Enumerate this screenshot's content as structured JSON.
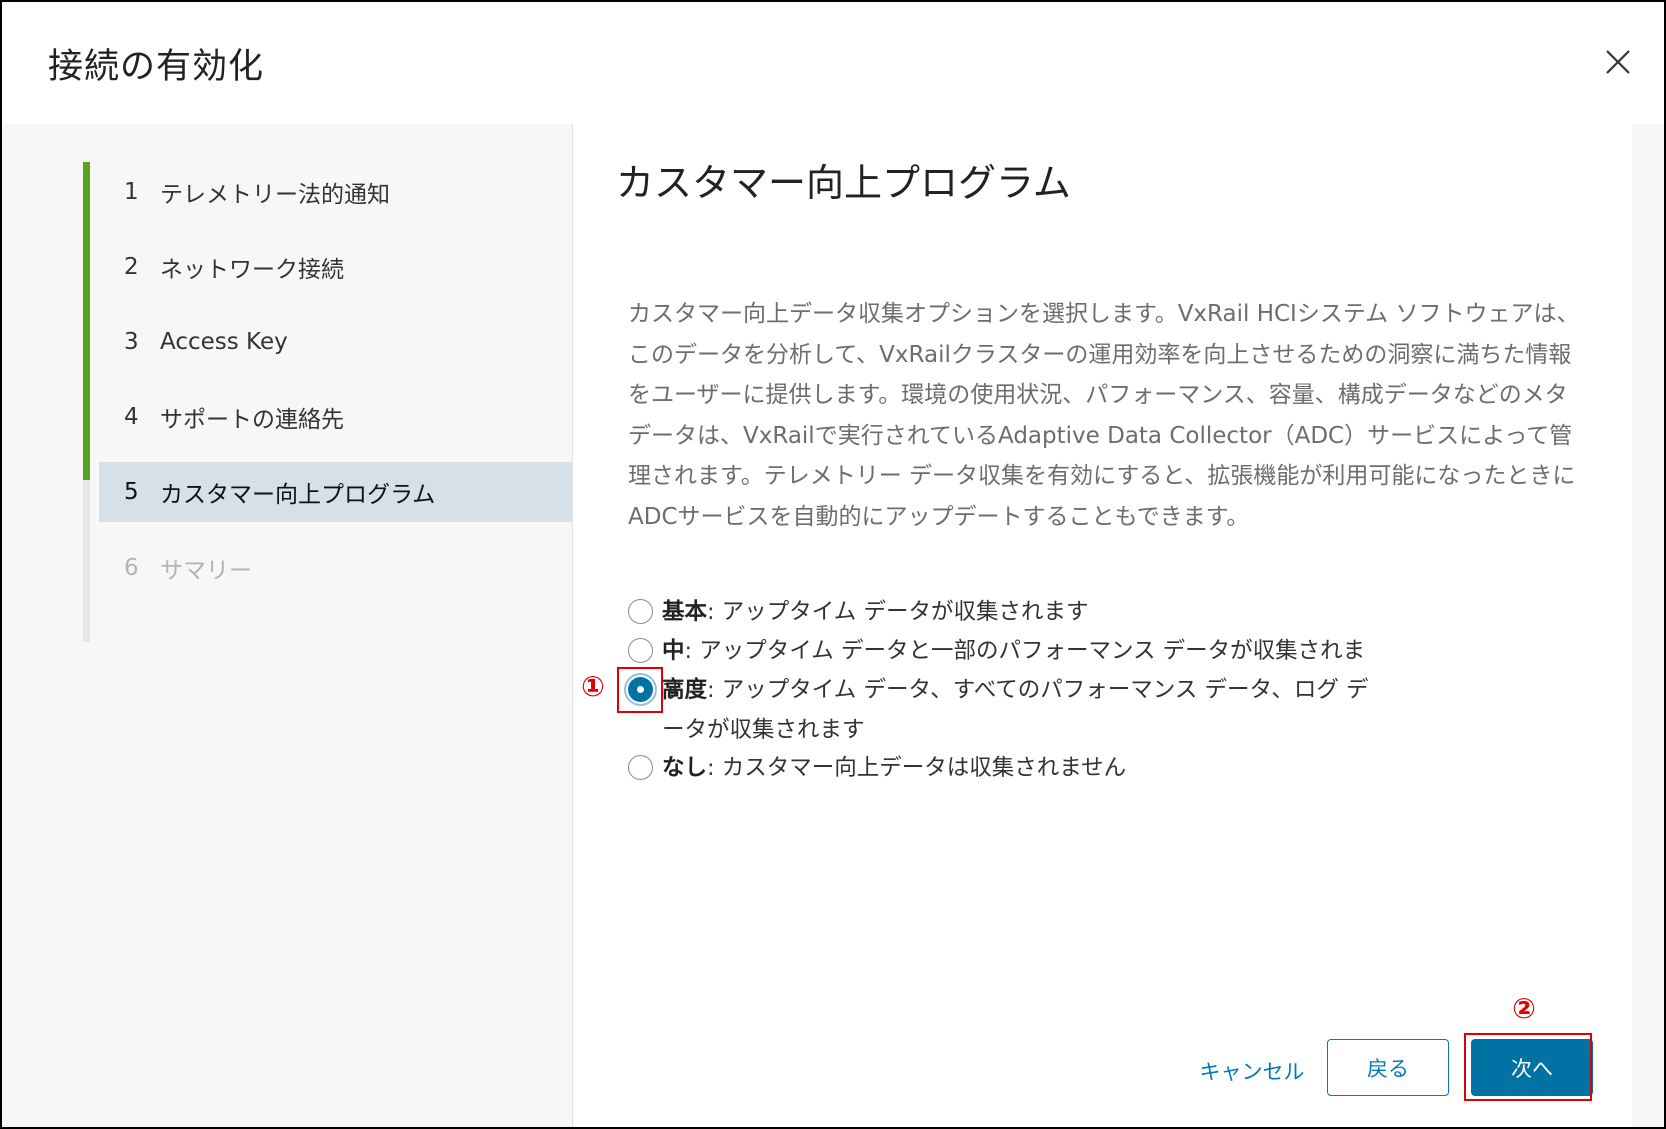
{
  "dialog": {
    "title": "接続の有効化",
    "close_icon": "close-icon"
  },
  "wizard": {
    "steps": [
      {
        "number": "1",
        "label": "テレメトリー法的通知",
        "state": "done"
      },
      {
        "number": "2",
        "label": "ネットワーク接続",
        "state": "done"
      },
      {
        "number": "3",
        "label": "Access Key",
        "state": "done"
      },
      {
        "number": "4",
        "label": "サポートの連絡先",
        "state": "done"
      },
      {
        "number": "5",
        "label": "カスタマー向上プログラム",
        "state": "active"
      },
      {
        "number": "6",
        "label": "サマリー",
        "state": "disabled"
      }
    ],
    "completed_steps": 4
  },
  "main": {
    "title": "カスタマー向上プログラム",
    "description": "カスタマー向上データ収集オプションを選択します。VxRail HCIシステム ソフトウェアは、このデータを分析して、VxRailクラスターの運用効率を向上させるための洞察に満ちた情報をユーザーに提供します。環境の使用状況、パフォーマンス、容量、構成データなどのメタデータは、VxRailで実行されているAdaptive Data Collector（ADC）サービスによって管理されます。テレメトリー データ収集を有効にすると、拡張機能が利用可能になったときにADCサービスを自動的にアップデートすることもできます。",
    "options": [
      {
        "name": "基本",
        "text": ": アップタイム データが収集されます",
        "selected": false
      },
      {
        "name": "中",
        "text": ": アップタイム データと一部のパフォーマンス データが収集されます",
        "selected": false
      },
      {
        "name": "高度",
        "text": ": アップタイム データ、すべてのパフォーマンス データ、ログ データが収集されます",
        "selected": true
      },
      {
        "name": "なし",
        "text": ": カスタマー向上データは収集されません",
        "selected": false
      }
    ]
  },
  "annotations": {
    "marker_1": "①",
    "marker_2": "②",
    "color": "#e00000"
  },
  "footer": {
    "cancel_label": "キャンセル",
    "back_label": "戻る",
    "next_label": "次へ"
  },
  "colors": {
    "progress_done": "#5aa220",
    "active_step_bg": "#d6e0e8",
    "primary": "#0072a3",
    "link": "#0079b8",
    "annotation_red": "#e00000"
  }
}
